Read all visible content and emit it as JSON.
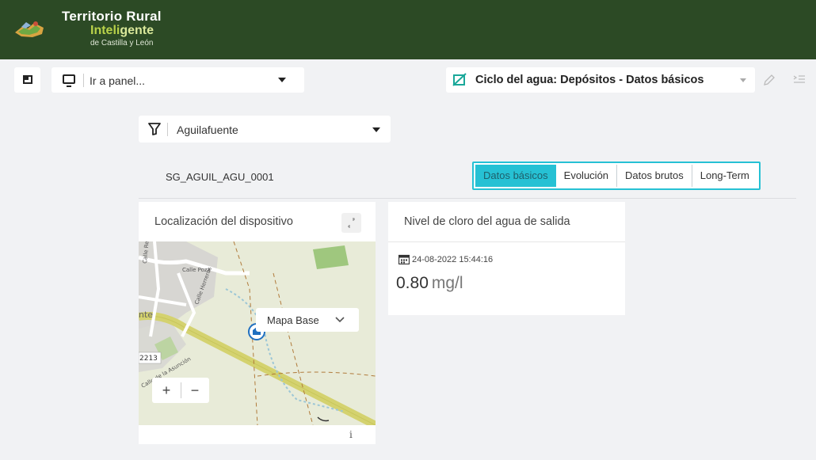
{
  "header": {
    "brand_line1": "Territorio Rural",
    "brand_line2a": "Inteli",
    "brand_line2b": "gente",
    "brand_line3": "de Castilla y León"
  },
  "toolbar": {
    "goto_placeholder": "Ir a panel...",
    "dashboard_title": "Ciclo del agua: Depósitos - Datos básicos"
  },
  "filter": {
    "selected": "Aguilafuente"
  },
  "device": {
    "id": "SG_AGUIL_AGU_0001"
  },
  "tabs": [
    {
      "label": "Datos básicos",
      "active": true
    },
    {
      "label": "Evolución",
      "active": false
    },
    {
      "label": "Datos brutos",
      "active": false
    },
    {
      "label": "Long-Term",
      "active": false
    }
  ],
  "map_card": {
    "title": "Localización del dispositivo",
    "map_base_label": "Mapa Base",
    "zoom_in": "+",
    "zoom_out": "−",
    "info": "i",
    "street_labels": [
      "Calle Real del C",
      "Calle Poza",
      "Calle Herreros",
      "nte",
      "2213",
      "Calle de la Asunción"
    ]
  },
  "chlorine_card": {
    "title": "Nivel de cloro del agua de salida",
    "date": "24-08-2022 15:44:16",
    "value": "0.80",
    "unit": "mg/l"
  },
  "colors": {
    "header_bg": "#2c4a25",
    "accent": "#26c1d4",
    "brand_green": "#b8d24a",
    "dashboard_icon": "#1aa89a"
  }
}
